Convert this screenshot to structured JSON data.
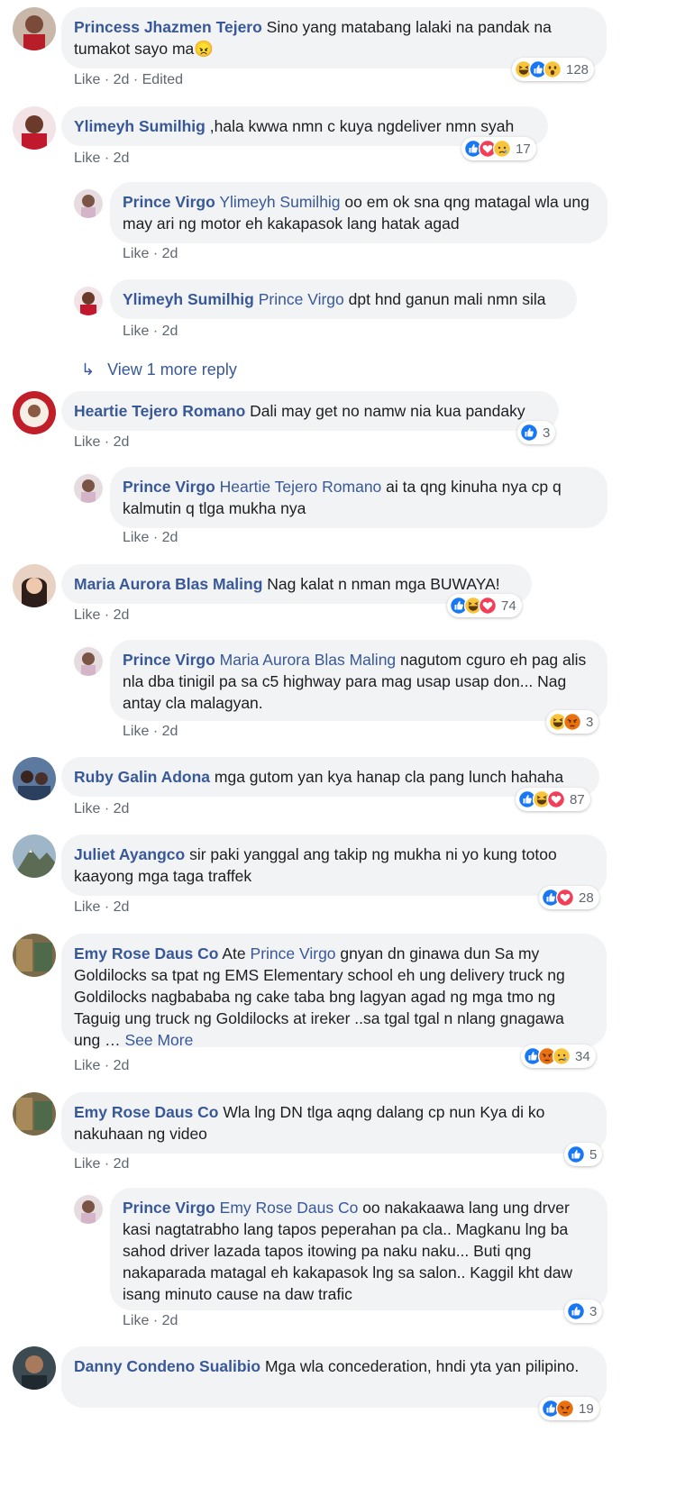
{
  "meta": {
    "like": "Like",
    "sep": "·",
    "edited": "Edited",
    "see_more": "See More",
    "ellipsis": "…"
  },
  "comments": [
    {
      "author": "Princess Jhazmen Tejero",
      "text": "Sino yang matabang lalaki na pandak na tumakot sayo ma",
      "emoji": "😠",
      "time": "2d",
      "edited": true,
      "reactions": [
        "haha",
        "like",
        "wow"
      ],
      "count": "128"
    },
    {
      "author": "Ylimeyh Sumilhig",
      "text": ",hala kwwa nmn c kuya ngdeliver nmn syah",
      "time": "2d",
      "reactions": [
        "like",
        "love",
        "sad"
      ],
      "count": "17",
      "replies": [
        {
          "author": "Prince Virgo",
          "mention": "Ylimeyh Sumilhig",
          "text": "oo em ok sna qng matagal wla ung may ari ng motor eh kakapasok lang hatak agad",
          "time": "2d"
        },
        {
          "author": "Ylimeyh Sumilhig",
          "mention": "Prince Virgo",
          "text": "dpt hnd ganun mali nmn sila",
          "time": "2d"
        }
      ],
      "view_more": "View 1 more reply"
    },
    {
      "author": "Heartie Tejero Romano",
      "text": "Dali may get no namw nia kua pandaky",
      "time": "2d",
      "reactions": [
        "like"
      ],
      "count": "3",
      "replies": [
        {
          "author": "Prince Virgo",
          "mention": "Heartie Tejero Romano",
          "text": "ai ta qng kinuha nya cp q kalmutin q tlga mukha nya",
          "time": "2d"
        }
      ]
    },
    {
      "author": "Maria Aurora Blas Maling",
      "text": "Nag kalat n nman mga BUWAYA!",
      "time": "2d",
      "reactions": [
        "like",
        "haha",
        "love"
      ],
      "count": "74",
      "replies": [
        {
          "author": "Prince Virgo",
          "mention": "Maria Aurora Blas Maling",
          "text": "nagutom cguro eh pag alis nla dba tinigil pa sa c5 highway para mag usap usap don... Nag antay cla malagyan.",
          "time": "2d",
          "reactions": [
            "haha",
            "angry"
          ],
          "count": "3"
        }
      ]
    },
    {
      "author": "Ruby Galin Adona",
      "text": "mga gutom yan kya hanap cla pang lunch hahaha",
      "time": "2d",
      "reactions": [
        "like",
        "haha",
        "love"
      ],
      "count": "87"
    },
    {
      "author": "Juliet Ayangco",
      "text": "sir paki yanggal ang takip ng mukha ni yo kung totoo kaayong mga taga traffek",
      "time": "2d",
      "reactions": [
        "like",
        "love"
      ],
      "count": "28"
    },
    {
      "author": "Emy Rose Daus Co",
      "pre": "Ate",
      "mention": "Prince Virgo",
      "text": "gnyan dn ginawa dun Sa my Goldilocks sa tpat ng EMS Elementary school eh ung delivery truck ng Goldilocks nagbababa ng cake taba bng lagyan agad ng mga tmo ng Taguig ung truck ng Goldilocks at ireker ..sa tgal tgal n nlang gnagawa ung",
      "time": "2d",
      "reactions": [
        "like",
        "angry",
        "sad"
      ],
      "count": "34"
    },
    {
      "author": "Emy Rose Daus Co",
      "text": "Wla lng DN tlga aqng dalang cp nun Kya di ko nakuhaan ng video",
      "time": "2d",
      "reactions": [
        "like"
      ],
      "count": "5",
      "replies": [
        {
          "author": "Prince Virgo",
          "mention": "Emy Rose Daus Co",
          "text": "oo nakakaawa lang ung drver kasi nagtatrabho lang tapos peperahan pa cla.. Magkanu lng ba sahod driver lazada tapos itowing pa naku naku... Buti qng nakaparada matagal eh kakapasok lng sa salon.. Kaggil kht daw isang minuto cause na daw trafic",
          "time": "2d",
          "reactions": [
            "like"
          ],
          "count": "3"
        }
      ]
    },
    {
      "author": "Danny Condeno Sualibio",
      "text": "Mga wla concederation, hndi yta yan pilipino.",
      "reactions": [
        "like",
        "angry"
      ],
      "count": "19"
    }
  ]
}
